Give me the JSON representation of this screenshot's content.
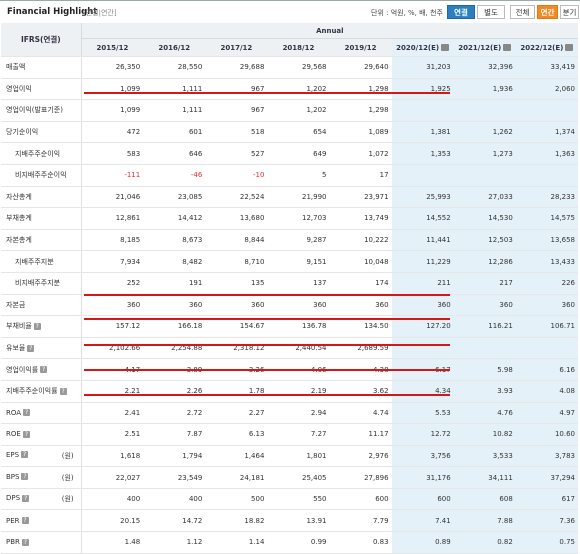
{
  "header": {
    "title": "Financial Highlight",
    "subtitle": "[연결|연간]",
    "unit": "단위 : 억원, %, 배, 천주",
    "btn_consolidated": "연결",
    "btn_separate": "별도",
    "btn_all": "전체",
    "btn_annual": "연간",
    "btn_quarter": "분기"
  },
  "table": {
    "corner": "IFRS(연결)",
    "annual": "Annual",
    "years": [
      "2015/12",
      "2016/12",
      "2017/12",
      "2018/12",
      "2019/12",
      "2020/12(E)",
      "2021/12(E)",
      "2022/12(E)"
    ],
    "rows": [
      {
        "label": "매출액",
        "values": [
          "26,350",
          "28,550",
          "29,688",
          "29,568",
          "29,640",
          "31,203",
          "32,396",
          "33,419"
        ]
      },
      {
        "label": "영업이익",
        "values": [
          "1,099",
          "1,111",
          "967",
          "1,202",
          "1,298",
          "1,925",
          "1,936",
          "2,060"
        ]
      },
      {
        "label": "영업이익(발표기준)",
        "values": [
          "1,099",
          "1,111",
          "967",
          "1,202",
          "1,298",
          "",
          "",
          ""
        ]
      },
      {
        "label": "당기순이익",
        "values": [
          "472",
          "601",
          "518",
          "654",
          "1,089",
          "1,381",
          "1,262",
          "1,374"
        ]
      },
      {
        "label": "지배주주순이익",
        "values": [
          "583",
          "646",
          "527",
          "649",
          "1,072",
          "1,353",
          "1,273",
          "1,363"
        ]
      },
      {
        "label": "비지배주주순이익",
        "values": [
          "-111",
          "-46",
          "-10",
          "5",
          "17",
          "",
          "",
          ""
        ]
      },
      {
        "label": "자산총계",
        "values": [
          "21,046",
          "23,085",
          "22,524",
          "21,990",
          "23,971",
          "25,993",
          "27,033",
          "28,233"
        ]
      },
      {
        "label": "부채총계",
        "values": [
          "12,861",
          "14,412",
          "13,680",
          "12,703",
          "13,749",
          "14,552",
          "14,530",
          "14,575"
        ]
      },
      {
        "label": "자본총계",
        "values": [
          "8,185",
          "8,673",
          "8,844",
          "9,287",
          "10,222",
          "11,441",
          "12,503",
          "13,658"
        ]
      },
      {
        "label": "지배주주지분",
        "values": [
          "7,934",
          "8,482",
          "8,710",
          "9,151",
          "10,048",
          "11,229",
          "12,286",
          "13,433"
        ]
      },
      {
        "label": "비지배주주지분",
        "values": [
          "252",
          "191",
          "135",
          "137",
          "174",
          "211",
          "217",
          "226"
        ]
      },
      {
        "label": "자본금",
        "values": [
          "360",
          "360",
          "360",
          "360",
          "360",
          "360",
          "360",
          "360"
        ]
      },
      {
        "label": "부채비율",
        "values": [
          "157.12",
          "166.18",
          "154.67",
          "136.78",
          "134.50",
          "127.20",
          "116.21",
          "106.71"
        ]
      },
      {
        "label": "유보율",
        "values": [
          "2,102.66",
          "2,254.88",
          "2,318.12",
          "2,440.54",
          "2,689.59",
          "",
          "",
          ""
        ]
      },
      {
        "label": "영업이익률",
        "values": [
          "4.17",
          "3.89",
          "3.26",
          "4.06",
          "4.38",
          "6.17",
          "5.98",
          "6.16"
        ]
      },
      {
        "label": "지배주주순이익률",
        "values": [
          "2.21",
          "2.26",
          "1.78",
          "2.19",
          "3.62",
          "4.34",
          "3.93",
          "4.08"
        ]
      },
      {
        "label": "ROA",
        "values": [
          "2.41",
          "2.72",
          "2.27",
          "2.94",
          "4.74",
          "5.53",
          "4.76",
          "4.97"
        ]
      },
      {
        "label": "ROE",
        "values": [
          "2.51",
          "7.87",
          "6.13",
          "7.27",
          "11.17",
          "12.72",
          "10.82",
          "10.60"
        ]
      },
      {
        "label": "EPS",
        "unit": "(원)",
        "values": [
          "1,618",
          "1,794",
          "1,464",
          "1,801",
          "2,976",
          "3,756",
          "3,533",
          "3,783"
        ]
      },
      {
        "label": "BPS",
        "unit": "(원)",
        "values": [
          "22,027",
          "23,549",
          "24,181",
          "25,405",
          "27,896",
          "31,176",
          "34,111",
          "37,294"
        ]
      },
      {
        "label": "DPS",
        "unit": "(원)",
        "values": [
          "400",
          "400",
          "500",
          "550",
          "600",
          "600",
          "608",
          "617"
        ]
      },
      {
        "label": "PER",
        "values": [
          "20.15",
          "14.72",
          "18.82",
          "13.91",
          "7.79",
          "7.41",
          "7.88",
          "7.36"
        ]
      },
      {
        "label": "PBR",
        "values": [
          "1.48",
          "1.12",
          "1.14",
          "0.99",
          "0.83",
          "0.89",
          "0.82",
          "0.75"
        ]
      }
    ]
  }
}
